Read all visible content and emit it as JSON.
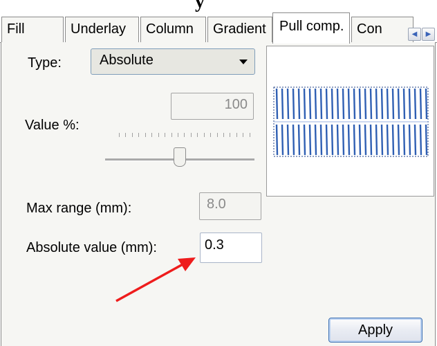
{
  "header": {
    "partial_title": "y"
  },
  "tabs": [
    {
      "label": "Fill",
      "active": false
    },
    {
      "label": "Underlay",
      "active": false
    },
    {
      "label": "Column",
      "active": false
    },
    {
      "label": "Gradient",
      "active": false
    },
    {
      "label": "Pull comp.",
      "active": true
    },
    {
      "label": "Con",
      "active": false
    }
  ],
  "tab_scroll": {
    "left_icon": "scroll-left-icon",
    "right_icon": "scroll-right-icon"
  },
  "form": {
    "type_label": "Type:",
    "type_value": "Absolute",
    "value_label": "Value %:",
    "value_field": "100",
    "value_slider_level": 0.5,
    "max_range_label": "Max range (mm):",
    "max_range_value": "8.0",
    "absolute_label": "Absolute value (mm):",
    "absolute_value": "0.3"
  },
  "preview": {
    "icon": "stitch-preview",
    "stitch_color": "#2f5fb3"
  },
  "annotation": {
    "icon": "red-arrow",
    "color": "#ee1c1c"
  },
  "actions": {
    "apply_label": "Apply"
  }
}
